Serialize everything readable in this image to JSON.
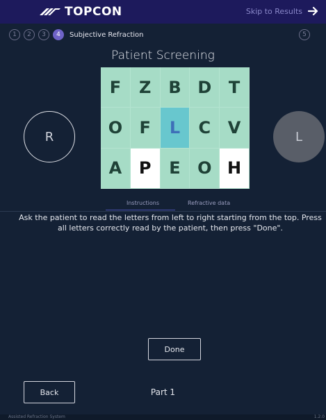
{
  "header": {
    "brand": "TOPCON",
    "skip_label": "Skip to Results",
    "skip_icon": "arrow-right-icon",
    "logo_icon": "topcon-logo-icon",
    "bar_color": "#1d1a5c"
  },
  "steps": {
    "items": [
      {
        "num": "1",
        "active": false
      },
      {
        "num": "2",
        "active": false
      },
      {
        "num": "3",
        "active": false
      },
      {
        "num": "4",
        "active": true
      }
    ],
    "current_label": "Subjective Refraction",
    "last": "5",
    "active_color": "#6e63c8"
  },
  "title": "Patient Screening",
  "letter_chart": {
    "rows": [
      [
        {
          "ch": "F",
          "state": "normal"
        },
        {
          "ch": "Z",
          "state": "normal"
        },
        {
          "ch": "B",
          "state": "normal"
        },
        {
          "ch": "D",
          "state": "normal"
        },
        {
          "ch": "T",
          "state": "normal"
        }
      ],
      [
        {
          "ch": "O",
          "state": "normal"
        },
        {
          "ch": "F",
          "state": "normal"
        },
        {
          "ch": "L",
          "state": "selected"
        },
        {
          "ch": "C",
          "state": "normal"
        },
        {
          "ch": "V",
          "state": "normal"
        }
      ],
      [
        {
          "ch": "A",
          "state": "normal"
        },
        {
          "ch": "P",
          "state": "white"
        },
        {
          "ch": "E",
          "state": "normal"
        },
        {
          "ch": "O",
          "state": "normal"
        },
        {
          "ch": "H",
          "state": "white"
        }
      ]
    ],
    "colors": {
      "bg": "#a6dcc6",
      "selected": "#68c7ce",
      "white": "#ffffff"
    }
  },
  "eyes": {
    "right": "R",
    "left": "L",
    "left_active": true
  },
  "tabs": {
    "instructions": "Instructions",
    "refractive": "Refractive data",
    "active": "instructions"
  },
  "instructions_text": "Ask the patient to read the letters from left to right starting from the top. Press all letters correctly read by the patient, then press \"Done\".",
  "buttons": {
    "done": "Done",
    "back": "Back"
  },
  "part_label": "Part 1",
  "footer": {
    "left": "Assisted Refraction System",
    "right": "1.2.0"
  }
}
